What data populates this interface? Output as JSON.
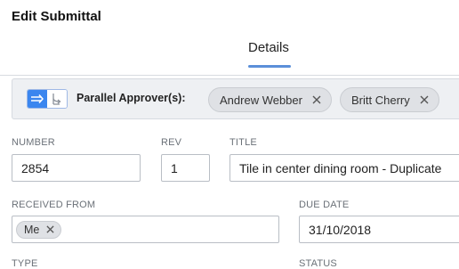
{
  "header": {
    "title": "Edit Submittal"
  },
  "tabs": [
    {
      "label": "Details",
      "active": true
    }
  ],
  "approvers": {
    "label": "Parallel Approver(s):",
    "mode": "parallel",
    "chips": [
      "Andrew Webber",
      "Britt Cherry"
    ]
  },
  "fields": {
    "number": {
      "label": "NUMBER",
      "value": "2854"
    },
    "rev": {
      "label": "REV",
      "value": "1"
    },
    "title": {
      "label": "TITLE",
      "value": "Tile in center dining room - Duplicate"
    },
    "received_from": {
      "label": "RECEIVED FROM",
      "tags": [
        "Me"
      ]
    },
    "due_date": {
      "label": "DUE DATE",
      "value": "31/10/2018"
    },
    "type": {
      "label": "TYPE"
    },
    "status": {
      "label": "STATUS"
    }
  },
  "colors": {
    "accent": "#3b86ef",
    "tab_underline": "#5b8fd9",
    "chip_bg": "#dfe1e5",
    "bar_bg": "#eef0f3"
  }
}
